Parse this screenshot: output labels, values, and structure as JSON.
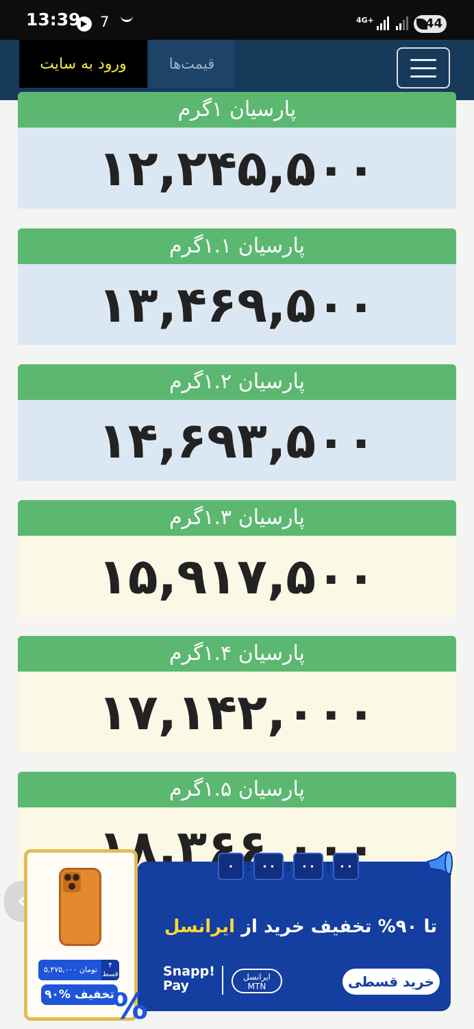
{
  "status_bar": {
    "time": "13:39",
    "notification_count": "7",
    "network": "4G+",
    "battery": "44"
  },
  "navbar": {
    "login": "ورود به سایت",
    "prices": "قیمت‌ها"
  },
  "cards": [
    {
      "title": "پارسیان ۱گرم",
      "price": "۱۲,۲۴۵,۵۰۰"
    },
    {
      "title": "پارسیان ۱.۱گرم",
      "price": "۱۳,۴۶۹,۵۰۰"
    },
    {
      "title": "پارسیان ۱.۲گرم",
      "price": "۱۴,۶۹۳,۵۰۰"
    },
    {
      "title": "پارسیان ۱.۳گرم",
      "price": "۱۵,۹۱۷,۵۰۰"
    },
    {
      "title": "پارسیان ۱.۴گرم",
      "price": "۱۷,۱۴۲,۰۰۰"
    },
    {
      "title": "پارسیان ۱.۵گرم",
      "price": "۱۸,۳۶۶,۰۰۰"
    }
  ],
  "ad": {
    "title_prefix": "تا ۹۰% تخفیف خرید از",
    "title_brand": "ایرانسل",
    "button": "خرید قسطی",
    "payment": {
      "line1": "Snapp!",
      "line2": "Pay"
    },
    "operator": {
      "line1": "ایرانسل",
      "line2": "MTN"
    },
    "timer": [
      "۰۰",
      "۰۰",
      "۰۰",
      "۰"
    ],
    "product_price": "۵,۴۷۵,۰۰۰ تومان",
    "installments": "۴",
    "installments_label": "قسط",
    "discount": "۹۰% تخفیف",
    "percent_symbol": "%"
  },
  "colors": {
    "navbar": "#173a5a",
    "card_header": "#5cb870",
    "login_text": "#f5ec3c",
    "ad_bg": "#143e9f"
  }
}
